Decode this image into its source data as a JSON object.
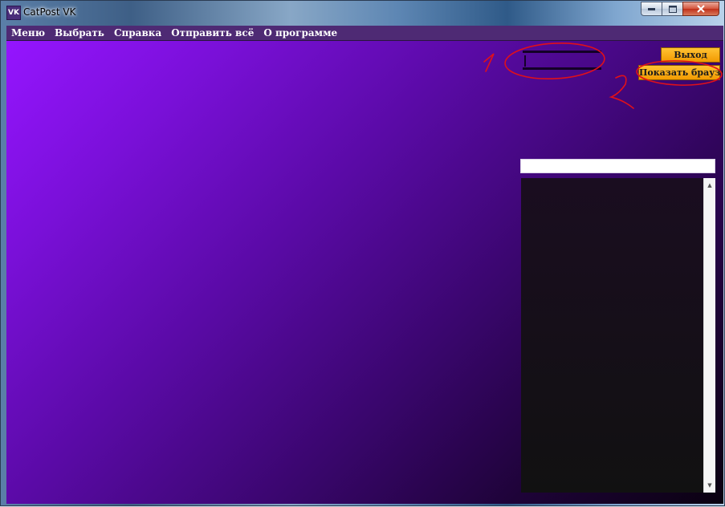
{
  "window": {
    "title": "CatPost VK",
    "icon": "vk-logo-icon",
    "icon_text": "VK"
  },
  "menu": {
    "items": [
      "Меню",
      "Выбрать",
      "Справка",
      "Отправить всё",
      "О программе"
    ]
  },
  "buttons": {
    "exit_label": "Выход",
    "show_browser_label": "Показать браузер",
    "accent_color": "#f29a00"
  },
  "colors": {
    "menubar": "#4e2a74",
    "background_start": "#9515ff",
    "background_end": "#0a0110"
  }
}
